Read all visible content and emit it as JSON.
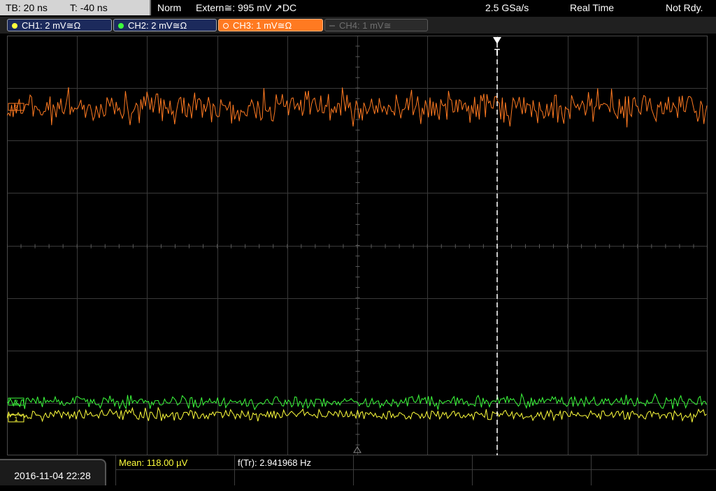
{
  "header": {
    "timebase": "TB: 20 ns",
    "trigger_offset": "T: -40 ns",
    "trigger_mode": "Norm",
    "trigger_source": "Extern≅: 995 mV ↗DC",
    "sample_rate": "2.5 GSa/s",
    "acquisition": "Real Time",
    "status": "Not Rdy."
  },
  "channels": [
    {
      "label": "CH1: 2 mV≅Ω",
      "color": "#ffff3c",
      "active": true
    },
    {
      "label": "CH2: 2 mV≅Ω",
      "color": "#3cff3c",
      "active": true
    },
    {
      "label": "CH3: 1 mV≅Ω",
      "color": "#ff7a21",
      "active": true
    },
    {
      "label": "CH4: 1 mV≅",
      "color": "#777777",
      "active": false
    }
  ],
  "markers": {
    "ch3": "3",
    "ch2": "2",
    "ch1": "1",
    "trigger": "T"
  },
  "measurements": {
    "mean": "Mean: 118.00 µV",
    "frequency": "f(Tr): 2.941968 Hz"
  },
  "datetime": "2016-11-04 22:28",
  "colors": {
    "ch1": "#ffff3c",
    "ch2": "#3cff3c",
    "ch3": "#ff7a21",
    "grid": "#3a3a3a"
  }
}
